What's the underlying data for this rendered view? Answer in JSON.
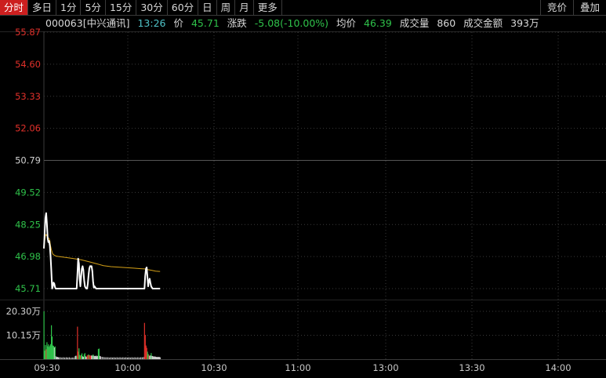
{
  "toolbar": {
    "tabs": [
      "分时",
      "多日",
      "1分",
      "5分",
      "15分",
      "30分",
      "60分",
      "日",
      "周",
      "月",
      "更多"
    ],
    "active_index": 0,
    "right_buttons": [
      "竞价",
      "叠加"
    ]
  },
  "info": {
    "code": "000063[中兴通讯]",
    "time": "13:26",
    "price_label": "价",
    "price": "45.71",
    "change_label": "涨跌",
    "change": "-5.08(-10.00%)",
    "avg_label": "均价",
    "avg": "46.39",
    "volume_label": "成交量",
    "volume": "860",
    "amount_label": "成交金额",
    "amount": "393万"
  },
  "colors": {
    "up": "#e0302a",
    "down": "#2fc24a",
    "neutral": "#d0d0d0",
    "price_line": "#ffffff",
    "avg_line": "#d4a017",
    "grid": "#3a3a3a",
    "active_tab": "#cc1f1f"
  },
  "chart_data": {
    "type": "line",
    "price_axis_ticks": [
      "55.87",
      "54.60",
      "53.33",
      "52.06",
      "50.79",
      "49.52",
      "48.25",
      "46.98",
      "45.71"
    ],
    "prev_close": 50.79,
    "ylim": [
      45.71,
      55.87
    ],
    "volume_axis_ticks": [
      "20.30万",
      "10.15万"
    ],
    "x_ticks": [
      "09:30",
      "10:00",
      "10:30",
      "11:00",
      "13:00",
      "13:30",
      "14:00"
    ],
    "series": [
      {
        "values": [
          [
            0,
            47.3
          ],
          [
            1,
            47.9
          ],
          [
            2,
            48.5
          ],
          [
            3,
            48.7
          ],
          [
            4,
            48.3
          ],
          [
            5,
            47.7
          ],
          [
            6,
            47.55
          ],
          [
            7,
            47.6
          ],
          [
            8,
            47.4
          ],
          [
            9,
            47.0
          ],
          [
            10,
            46.4
          ],
          [
            11,
            45.71
          ],
          [
            12,
            45.8
          ],
          [
            13,
            45.95
          ],
          [
            14,
            45.9
          ],
          [
            15,
            45.75
          ],
          [
            16,
            45.71
          ],
          [
            20,
            45.71
          ],
          [
            28,
            45.71
          ],
          [
            36,
            45.71
          ],
          [
            44,
            45.71
          ],
          [
            45,
            46.3
          ],
          [
            46,
            46.9
          ],
          [
            47,
            46.7
          ],
          [
            48,
            46.1
          ],
          [
            49,
            45.8
          ],
          [
            50,
            46.2
          ],
          [
            51,
            46.5
          ],
          [
            52,
            46.6
          ],
          [
            53,
            46.45
          ],
          [
            54,
            46.05
          ],
          [
            55,
            45.8
          ],
          [
            56,
            45.75
          ],
          [
            57,
            45.71
          ],
          [
            58,
            45.71
          ],
          [
            59,
            45.9
          ],
          [
            60,
            46.25
          ],
          [
            61,
            46.5
          ],
          [
            62,
            46.6
          ],
          [
            63,
            46.6
          ],
          [
            64,
            46.6
          ],
          [
            65,
            46.4
          ],
          [
            66,
            46.0
          ],
          [
            67,
            45.75
          ],
          [
            68,
            45.8
          ],
          [
            69,
            45.76
          ],
          [
            70,
            45.71
          ],
          [
            80,
            45.71
          ],
          [
            90,
            45.71
          ],
          [
            100,
            45.71
          ],
          [
            110,
            45.71
          ],
          [
            120,
            45.71
          ],
          [
            130,
            45.71
          ],
          [
            135,
            45.71
          ],
          [
            136,
            46.2
          ],
          [
            137,
            46.5
          ],
          [
            138,
            46.55
          ],
          [
            139,
            46.2
          ],
          [
            140,
            45.8
          ],
          [
            141,
            46.0
          ],
          [
            142,
            46.1
          ],
          [
            143,
            45.95
          ],
          [
            144,
            45.8
          ],
          [
            145,
            45.75
          ],
          [
            146,
            45.71
          ],
          [
            155,
            45.71
          ],
          [
            156,
            45.71
          ]
        ]
      },
      {
        "values": [
          [
            0,
            47.3
          ],
          [
            1,
            47.6
          ],
          [
            2,
            47.8
          ],
          [
            3,
            47.85
          ],
          [
            4,
            47.8
          ],
          [
            5,
            47.75
          ],
          [
            6,
            47.72
          ],
          [
            7,
            47.7
          ],
          [
            8,
            47.6
          ],
          [
            9,
            47.4
          ],
          [
            10,
            47.25
          ],
          [
            11,
            47.15
          ],
          [
            12,
            47.08
          ],
          [
            14,
            47.03
          ],
          [
            16,
            47.0
          ],
          [
            20,
            46.98
          ],
          [
            30,
            46.94
          ],
          [
            40,
            46.9
          ],
          [
            50,
            46.85
          ],
          [
            60,
            46.78
          ],
          [
            70,
            46.7
          ],
          [
            80,
            46.62
          ],
          [
            90,
            46.58
          ],
          [
            100,
            46.56
          ],
          [
            110,
            46.54
          ],
          [
            120,
            46.52
          ],
          [
            130,
            46.5
          ],
          [
            135,
            46.49
          ],
          [
            140,
            46.46
          ],
          [
            145,
            46.43
          ],
          [
            150,
            46.4
          ],
          [
            155,
            46.39
          ],
          [
            156,
            46.39
          ]
        ]
      }
    ],
    "volume": {
      "bars": [
        [
          0,
          20.3,
          "down"
        ],
        [
          1,
          3.6,
          "down"
        ],
        [
          2,
          6.0,
          "down"
        ],
        [
          3,
          4.2,
          "up"
        ],
        [
          4,
          7.2,
          "down"
        ],
        [
          5,
          5.5,
          "down"
        ],
        [
          6,
          6.3,
          "down"
        ],
        [
          7,
          5.2,
          "down"
        ],
        [
          8,
          5.8,
          "down"
        ],
        [
          9,
          6.4,
          "down"
        ],
        [
          10,
          14.4,
          "down"
        ],
        [
          11,
          9.6,
          "down"
        ],
        [
          12,
          5.8,
          "down"
        ],
        [
          13,
          5.6,
          "down"
        ],
        [
          14,
          5.0,
          "neutral"
        ],
        [
          15,
          5.4,
          "down"
        ],
        [
          16,
          1.2,
          "neutral"
        ],
        [
          17,
          0.9,
          "neutral"
        ],
        [
          18,
          1.0,
          "neutral"
        ],
        [
          19,
          0.8,
          "neutral"
        ],
        [
          20,
          0.8,
          "neutral"
        ],
        [
          22,
          0.8,
          "neutral"
        ],
        [
          24,
          0.7,
          "neutral"
        ],
        [
          26,
          0.8,
          "neutral"
        ],
        [
          28,
          0.7,
          "neutral"
        ],
        [
          30,
          0.8,
          "neutral"
        ],
        [
          32,
          0.7,
          "neutral"
        ],
        [
          34,
          0.8,
          "neutral"
        ],
        [
          36,
          0.6,
          "neutral"
        ],
        [
          38,
          0.7,
          "neutral"
        ],
        [
          40,
          0.7,
          "neutral"
        ],
        [
          42,
          1.3,
          "neutral"
        ],
        [
          43,
          1.5,
          "neutral"
        ],
        [
          44,
          1.2,
          "down"
        ],
        [
          45,
          13.8,
          "up"
        ],
        [
          46,
          3.2,
          "up"
        ],
        [
          47,
          4.6,
          "down"
        ],
        [
          48,
          1.8,
          "down"
        ],
        [
          49,
          1.5,
          "up"
        ],
        [
          50,
          1.8,
          "down"
        ],
        [
          51,
          2.5,
          "down"
        ],
        [
          52,
          1.2,
          "neutral"
        ],
        [
          53,
          1.0,
          "neutral"
        ],
        [
          54,
          2.1,
          "down"
        ],
        [
          55,
          2.6,
          "down"
        ],
        [
          56,
          1.2,
          "neutral"
        ],
        [
          57,
          1.0,
          "neutral"
        ],
        [
          58,
          1.6,
          "up"
        ],
        [
          59,
          1.8,
          "up"
        ],
        [
          60,
          2.0,
          "down"
        ],
        [
          61,
          1.7,
          "up"
        ],
        [
          62,
          1.6,
          "up"
        ],
        [
          63,
          1.4,
          "up"
        ],
        [
          64,
          1.6,
          "neutral"
        ],
        [
          65,
          1.5,
          "neutral"
        ],
        [
          66,
          2.0,
          "down"
        ],
        [
          67,
          1.5,
          "neutral"
        ],
        [
          68,
          1.3,
          "neutral"
        ],
        [
          69,
          1.3,
          "neutral"
        ],
        [
          70,
          1.5,
          "neutral"
        ],
        [
          71,
          1.2,
          "neutral"
        ],
        [
          72,
          1.4,
          "neutral"
        ],
        [
          73,
          4.3,
          "down"
        ],
        [
          74,
          4.5,
          "down"
        ],
        [
          75,
          1.4,
          "neutral"
        ],
        [
          76,
          1.2,
          "neutral"
        ],
        [
          78,
          1.0,
          "neutral"
        ],
        [
          80,
          0.9,
          "neutral"
        ],
        [
          82,
          0.8,
          "neutral"
        ],
        [
          84,
          0.8,
          "neutral"
        ],
        [
          86,
          0.8,
          "neutral"
        ],
        [
          88,
          0.7,
          "neutral"
        ],
        [
          90,
          0.8,
          "neutral"
        ],
        [
          92,
          0.7,
          "neutral"
        ],
        [
          94,
          0.8,
          "neutral"
        ],
        [
          96,
          0.7,
          "neutral"
        ],
        [
          98,
          0.8,
          "neutral"
        ],
        [
          100,
          0.7,
          "neutral"
        ],
        [
          102,
          0.8,
          "neutral"
        ],
        [
          104,
          0.7,
          "neutral"
        ],
        [
          106,
          0.8,
          "neutral"
        ],
        [
          108,
          0.7,
          "neutral"
        ],
        [
          110,
          0.8,
          "neutral"
        ],
        [
          112,
          0.7,
          "neutral"
        ],
        [
          114,
          0.8,
          "neutral"
        ],
        [
          116,
          0.7,
          "neutral"
        ],
        [
          118,
          0.8,
          "neutral"
        ],
        [
          120,
          0.7,
          "neutral"
        ],
        [
          122,
          0.8,
          "neutral"
        ],
        [
          124,
          0.7,
          "neutral"
        ],
        [
          126,
          0.8,
          "neutral"
        ],
        [
          128,
          0.7,
          "neutral"
        ],
        [
          130,
          0.8,
          "neutral"
        ],
        [
          132,
          0.8,
          "neutral"
        ],
        [
          134,
          0.9,
          "neutral"
        ],
        [
          135,
          15.4,
          "up"
        ],
        [
          136,
          10.3,
          "up"
        ],
        [
          137,
          5.8,
          "up"
        ],
        [
          138,
          4.8,
          "up"
        ],
        [
          139,
          3.2,
          "down"
        ],
        [
          140,
          2.2,
          "down"
        ],
        [
          141,
          1.8,
          "up"
        ],
        [
          142,
          1.4,
          "neutral"
        ],
        [
          143,
          1.6,
          "neutral"
        ],
        [
          144,
          2.6,
          "down"
        ],
        [
          145,
          1.4,
          "neutral"
        ],
        [
          146,
          1.3,
          "neutral"
        ],
        [
          147,
          1.2,
          "neutral"
        ],
        [
          148,
          1.0,
          "neutral"
        ],
        [
          149,
          1.2,
          "neutral"
        ],
        [
          150,
          1.0,
          "neutral"
        ],
        [
          151,
          0.9,
          "neutral"
        ],
        [
          152,
          1.0,
          "neutral"
        ],
        [
          153,
          0.8,
          "neutral"
        ],
        [
          154,
          1.0,
          "neutral"
        ],
        [
          155,
          0.9,
          "neutral"
        ],
        [
          156,
          0.8,
          "neutral"
        ]
      ],
      "max": 20.3
    }
  }
}
